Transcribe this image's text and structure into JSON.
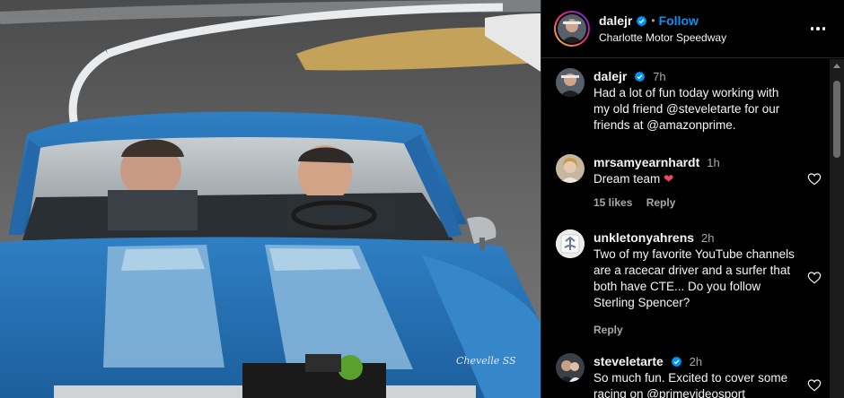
{
  "header": {
    "username": "dalejr",
    "separator": "•",
    "follow_label": "Follow",
    "location": "Charlotte Motor Speedway",
    "more_icon": "more-options-icon"
  },
  "caption": {
    "username": "dalejr",
    "time": "7h",
    "text": "Had a lot of fun today working with my old friend @steveletarte for our friends at @amazonprime."
  },
  "comments": [
    {
      "username": "mrsamyearnhardt",
      "time": "1h",
      "text": "Dream team",
      "emoji": "❤",
      "likes": "15 likes",
      "reply": "Reply"
    },
    {
      "username": "unkletonyahrens",
      "time": "2h",
      "text": "Two of my favorite YouTube channels are a racecar driver and a surfer that both have CTE... Do you follow Sterling Spencer?",
      "reply": "Reply"
    },
    {
      "username": "steveletarte",
      "time": "2h",
      "text": "So much fun. Excited to cover some racing on @primevideosport"
    }
  ],
  "photo": {
    "badge": "Chevelle SS"
  },
  "colors": {
    "accent": "#0095f6",
    "verified": "#0095f6",
    "heart": "#ed4956",
    "background": "#000000",
    "secondary_text": "#a8a8a8"
  }
}
